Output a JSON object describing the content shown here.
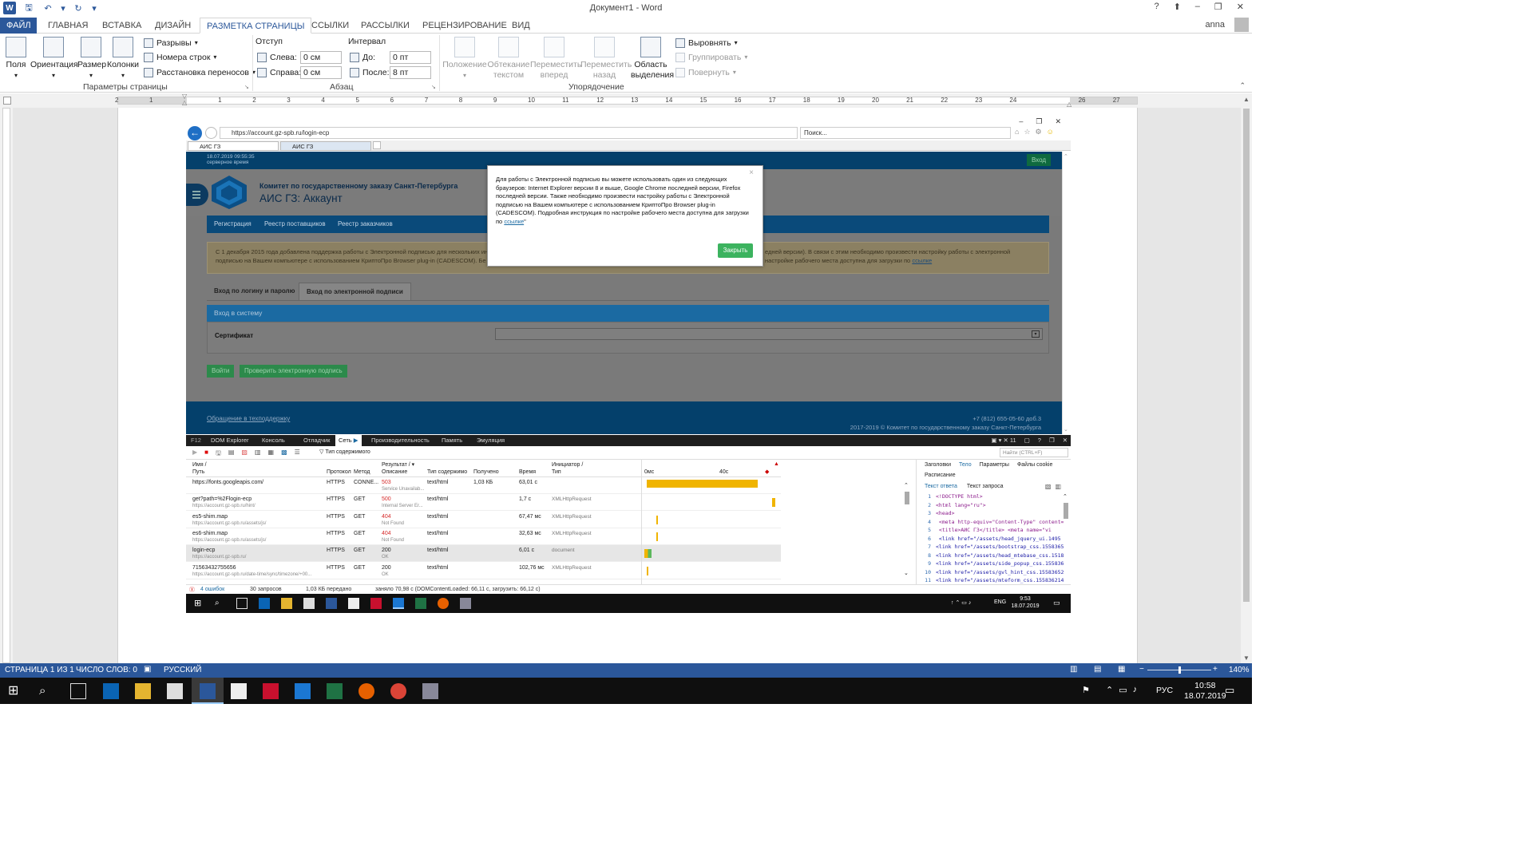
{
  "word": {
    "app_title": "Документ1 - Word",
    "account": "anna",
    "tabs": [
      "ФАЙЛ",
      "ГЛАВНАЯ",
      "ВСТАВКА",
      "ДИЗАЙН",
      "РАЗМЕТКА СТРАНИЦЫ",
      "ССЫЛКИ",
      "РАССЫЛКИ",
      "РЕЦЕНЗИРОВАНИЕ",
      "ВИД"
    ],
    "active_tab": "РАЗМЕТКА СТРАНИЦЫ",
    "ribbon": {
      "page_setup": {
        "margins": "Поля",
        "orientation": "Ориентация",
        "size": "Размер",
        "columns": "Колонки",
        "breaks": "Разрывы",
        "line_numbers": "Номера строк",
        "hyphenation": "Расстановка переносов",
        "group_label": "Параметры страницы"
      },
      "paragraph": {
        "indent_label": "Отступ",
        "spacing_label": "Интервал",
        "left_label": "Слева:",
        "left_value": "0 см",
        "right_label": "Справа:",
        "right_value": "0 см",
        "before_label": "До:",
        "before_value": "0 пт",
        "after_label": "После:",
        "after_value": "8 пт",
        "group_label": "Абзац"
      },
      "arrange": {
        "position": "Положение",
        "wrap_text_1": "Обтекание",
        "wrap_text_2": "текстом",
        "bring_forward_1": "Переместить",
        "bring_forward_2": "вперед",
        "send_backward_1": "Переместить",
        "send_backward_2": "назад",
        "selection_pane_1": "Область",
        "selection_pane_2": "выделения",
        "align": "Выровнять",
        "group": "Группировать",
        "rotate": "Повернуть",
        "group_label": "Упорядочение"
      }
    },
    "ruler_numbers": [
      "2",
      "1",
      "1",
      "2",
      "3",
      "4",
      "5",
      "6",
      "7",
      "8",
      "9",
      "10",
      "11",
      "12",
      "13",
      "14",
      "15",
      "16",
      "17",
      "18",
      "19",
      "20",
      "21",
      "22",
      "23",
      "24",
      "26",
      "27"
    ],
    "status": {
      "page": "СТРАНИЦА 1 ИЗ 1",
      "words": "ЧИСЛО СЛОВ: 0",
      "language": "РУССКИЙ",
      "zoom": "140%"
    }
  },
  "browser": {
    "url": "https://account.gz-spb.ru/login-ecp",
    "search_placeholder": "Поиск...",
    "tabs": [
      "АИС ГЗ",
      "АИС ГЗ"
    ]
  },
  "site": {
    "datetime": "18.07.2019 09:55:35",
    "time_note": "серверное время",
    "login_button": "Вход",
    "org_name": "Комитет по государственному заказу Санкт-Петербурга",
    "app_title": "АИС ГЗ: Аккаунт",
    "nav": [
      "Регистрация",
      "Реестр поставщиков",
      "Реестр заказчиков"
    ],
    "notice_line1": "С 1 декабря 2015 года добавлена поддержка работы с Электронной подписью для нескольких ин",
    "notice_line1_end": "едней версии). В связи с этим необходимо произвести настройку работы с электронной",
    "notice_line2": "подписью на Вашем компьютере с использованием КриптоПро Browser plug-in (CADESCOM). Бе",
    "notice_line2_end": "настройке рабочего места доступна для загрузки по",
    "notice_link": "ссылке",
    "login_tabs": [
      "Вход по логину и паролю",
      "Вход по электронной подписи"
    ],
    "panel_title": "Вход в систему",
    "cert_label": "Сертификат",
    "enter_button": "Войти",
    "check_button": "Проверить электронную подпись",
    "support_link": "Обращение в техподдержку",
    "phone": "+7 (812) 655-05-60 доб.3",
    "copyright": "2017-2019 © Комитет по государственному заказу Санкт-Петербурга"
  },
  "modal": {
    "text": "Для работы с Электронной подписью вы можете использовать один из следующих браузеров: Internet Explorer версии 8 и выше, Google Chrome последней версии, Firefox последней версии. Также необходимо произвести настройку работы с Электронной подписью на Вашем компьютере с использованием КриптоПро Browser plug-in (CADESCOM). Подробная инструкция по настройке рабочего места доступна для загрузки по",
    "link": "ссылке",
    "close_button": "Закрыть"
  },
  "devtools": {
    "tabs": [
      "F12",
      "DOM Explorer",
      "Консоль",
      "Отладчик",
      "Сеть",
      "Производительность",
      "Память",
      "Эмуляция"
    ],
    "errors_count_badge": "11",
    "filter_label": "Тип содержимого",
    "find_placeholder": "Найти (CTRL+F)",
    "columns": {
      "name": "Имя /",
      "path": "Путь",
      "protocol": "Протокол",
      "method": "Метод",
      "result": "Результат /",
      "description": "Описание",
      "content_type": "Тип содержимо",
      "received": "Получено",
      "time": "Время",
      "initiator": "Инициатор /",
      "type": "Тип",
      "t0": "0мс",
      "t40": "40с"
    },
    "rows": [
      {
        "name": "https://fonts.googleapis.com/",
        "path": "",
        "protocol": "HTTPS",
        "method": "CONNE...",
        "result": "503",
        "desc": "Service Unavailab...",
        "ctype": "text/html",
        "received": "1,03 КБ",
        "time": "63,01 с",
        "initiator": "",
        "err": true
      },
      {
        "name": "get?path=%2Flogin-ecp",
        "path": "https://account.gz-spb.ru/hint/",
        "protocol": "HTTPS",
        "method": "GET",
        "result": "500",
        "desc": "Internal Server Er...",
        "ctype": "text/html",
        "received": "",
        "time": "1,7 с",
        "initiator": "XMLHttpRequest",
        "err": true
      },
      {
        "name": "es5-shim.map",
        "path": "https://account.gz-spb.ru/assets/js/",
        "protocol": "HTTPS",
        "method": "GET",
        "result": "404",
        "desc": "Not Found",
        "ctype": "text/html",
        "received": "",
        "time": "67,47 мс",
        "initiator": "XMLHttpRequest",
        "err": true
      },
      {
        "name": "es6-shim.map",
        "path": "https://account.gz-spb.ru/assets/js/",
        "protocol": "HTTPS",
        "method": "GET",
        "result": "404",
        "desc": "Not Found",
        "ctype": "text/html",
        "received": "",
        "time": "32,63 мс",
        "initiator": "XMLHttpRequest",
        "err": true
      },
      {
        "name": "login-ecp",
        "path": "https://account.gz-spb.ru/",
        "protocol": "HTTPS",
        "method": "GET",
        "result": "200",
        "desc": "OK",
        "ctype": "text/html",
        "received": "",
        "time": "6,01 с",
        "initiator": "document",
        "err": false
      },
      {
        "name": "71563432755656",
        "path": "https://account.gz-spb.ru/date-time/sync/timezone/+00...",
        "protocol": "HTTPS",
        "method": "GET",
        "result": "200",
        "desc": "OK",
        "ctype": "text/html",
        "received": "",
        "time": "102,76 мс",
        "initiator": "XMLHttpRequest",
        "err": false
      }
    ],
    "right_tabs": [
      "Заголовки",
      "Тело",
      "Параметры",
      "Файлы cookie",
      "Расписание"
    ],
    "body_tabs": [
      "Текст ответа",
      "Текст запроса"
    ],
    "code": [
      {
        "n": "1",
        "t": "<!DOCTYPE html>"
      },
      {
        "n": "2",
        "t": "<html lang=\"ru\">"
      },
      {
        "n": "3",
        "t": "<head>"
      },
      {
        "n": "4",
        "t": "    <meta http-equiv=\"Content-Type\" content="
      },
      {
        "n": "5",
        "t": "    <title>АИС ГЗ</title>    <meta name=\"vi"
      },
      {
        "n": "6",
        "t": "    <link href=\"/assets/head_jquery_ui.1495"
      },
      {
        "n": "7",
        "t": "<link href=\"/assets/bootstrap_css.155836520"
      },
      {
        "n": "8",
        "t": "<link href=\"/assets/head_mtebase_css.151816"
      },
      {
        "n": "9",
        "t": "<link href=\"/assets/side_popup_css.15583651"
      },
      {
        "n": "10",
        "t": "<link href=\"/assets/gvl_hint_css.155836527"
      },
      {
        "n": "11",
        "t": "<link href=\"/assets/mteform_css.155836214.c"
      }
    ],
    "status": {
      "errors": "4 ошибок",
      "requests": "30 запросов",
      "transferred": "1,03 КБ передано",
      "timing": "заняло 70,98 с (DOMContentLoaded: 66,11 с, загрузить: 66,12 с)"
    }
  },
  "embedded_taskbar": {
    "lang": "ENG",
    "time": "9:53",
    "date": "18.07.2019"
  },
  "taskbar": {
    "lang": "РУС",
    "time": "10:58",
    "date": "18.07.2019"
  },
  "colors": {
    "word_blue": "#2b579a",
    "site_navy": "#04406b",
    "accept_green": "#3cb35f",
    "error_red": "#d62b2b",
    "timeline_orange": "#f0b400"
  }
}
